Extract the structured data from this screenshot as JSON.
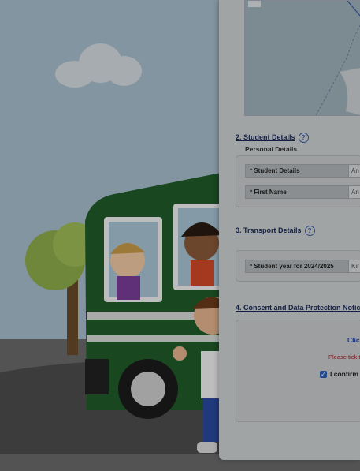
{
  "sections": {
    "student": {
      "title": "2. Student Details",
      "subheading": "Personal Details"
    },
    "transport": {
      "title": "3. Transport Details"
    },
    "consent": {
      "title": "4. Consent and Data Protection Notic"
    }
  },
  "help_icon": "?",
  "fields": {
    "student_details": {
      "label": "* Student Details",
      "value": "An"
    },
    "first_name": {
      "label": "* First Name",
      "value": "An"
    },
    "student_year": {
      "label": "* Student year for 2024/2025",
      "value": "Kir"
    }
  },
  "consent": {
    "link_text": "Clic",
    "warning": "Please tick t",
    "confirm_label": "I confirm",
    "checked": true
  },
  "icons": [
    "help-icon",
    "checkbox-icon",
    "cloud-icon"
  ],
  "colors": {
    "overlay": "#000000",
    "link": "#2b4aa8",
    "warning": "#a3232c",
    "bus": "#1f5b2a"
  }
}
